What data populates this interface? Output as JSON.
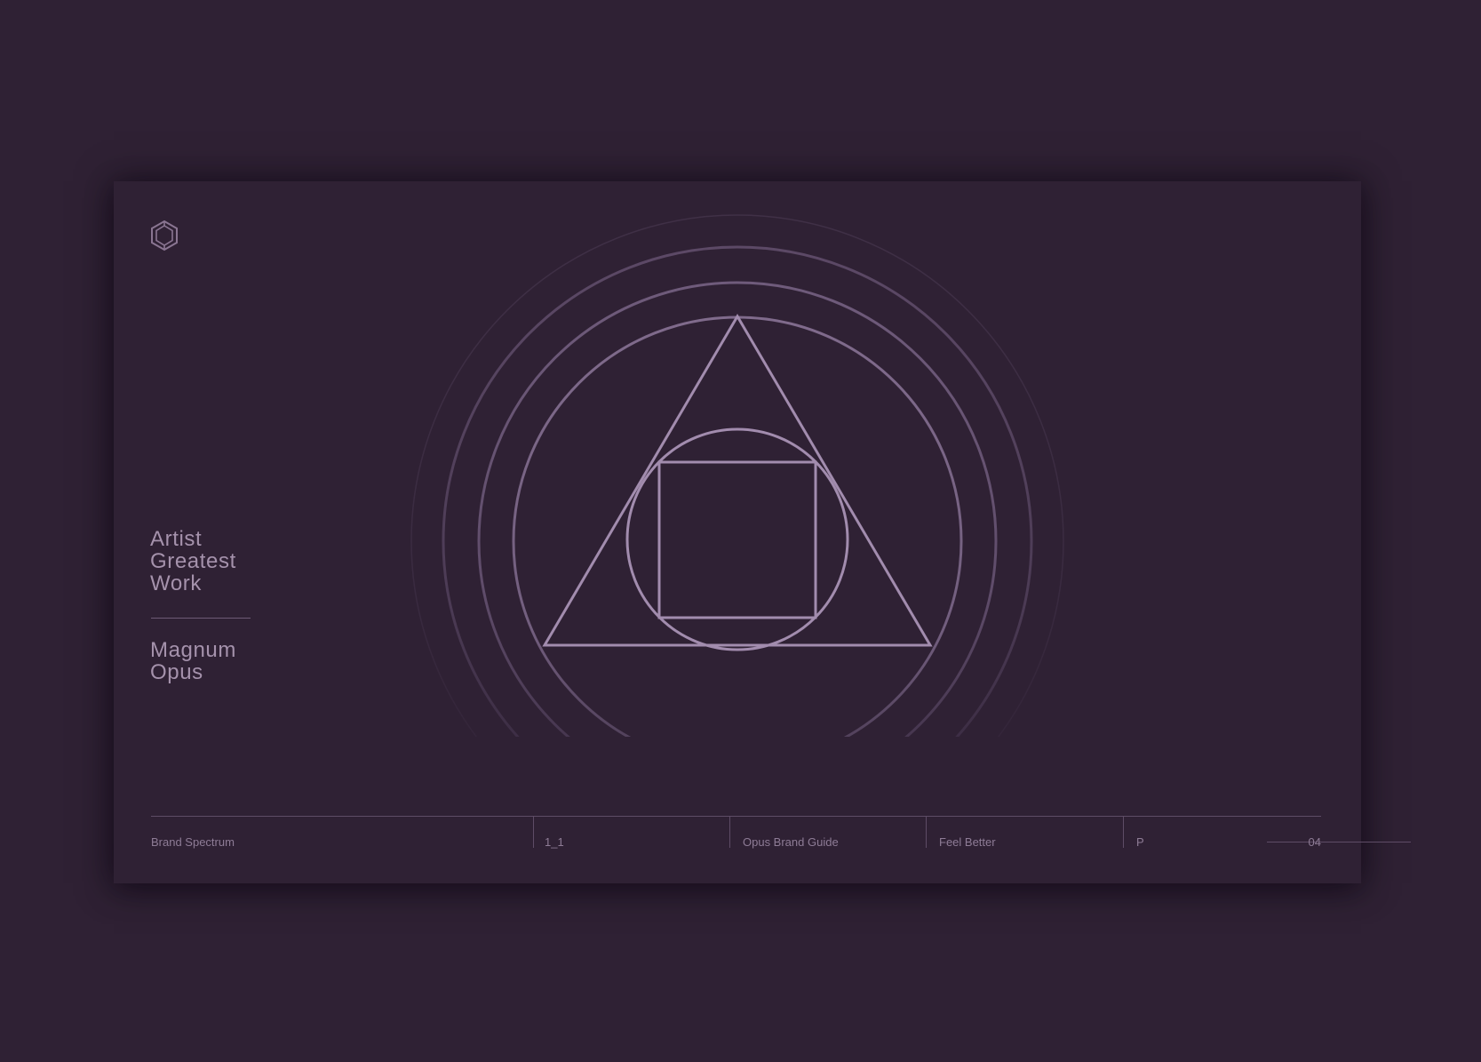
{
  "slide": {
    "title_lines": [
      "Artist",
      "Greatest",
      "Work"
    ],
    "subtitle_lines": [
      "Magnum",
      "Opus"
    ]
  },
  "logo": {
    "icon": "hexagon-logo-icon"
  },
  "emblem": {
    "icon": "geometric-emblem-icon"
  },
  "footer": {
    "section": "Brand Spectrum",
    "code": "1_1",
    "document": "Opus Brand Guide",
    "tagline": "Feel Better",
    "page_prefix": "P",
    "page_number": "04"
  },
  "colors": {
    "background": "#2f2134",
    "text": "#a592ac",
    "line": "#5e4c66",
    "emblem_stroke": "#a28cae"
  }
}
